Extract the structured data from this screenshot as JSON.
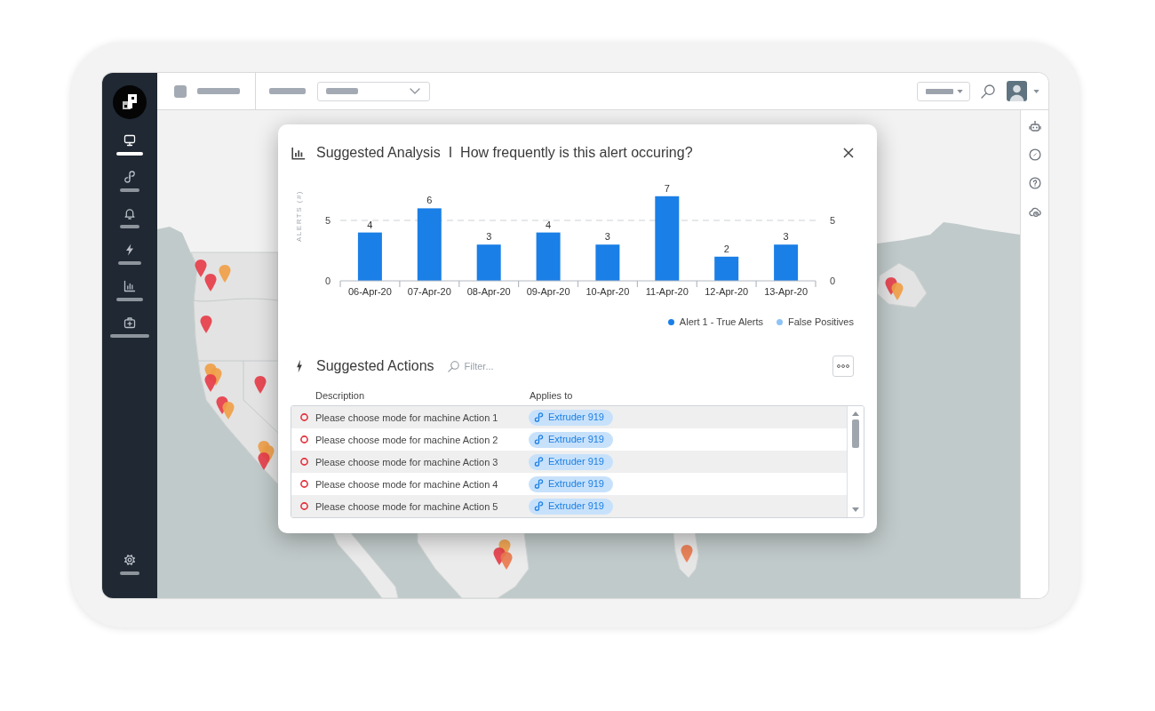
{
  "sidebar": {
    "items": [
      {
        "selected": true
      },
      {
        "selected": false
      },
      {
        "selected": false
      },
      {
        "selected": false
      },
      {
        "selected": false
      },
      {
        "selected": false
      }
    ],
    "footer_items": [
      {
        "selected": false
      }
    ]
  },
  "analysis": {
    "title": "Suggested Analysis",
    "separator": "I",
    "question": "How frequently is this alert occuring?",
    "chart_data": {
      "type": "bar",
      "ylabel": "ALERTS (#)",
      "categories": [
        "06-Apr-20",
        "07-Apr-20",
        "08-Apr-20",
        "09-Apr-20",
        "10-Apr-20",
        "11-Apr-20",
        "12-Apr-20",
        "13-Apr-20"
      ],
      "series": [
        {
          "name": "Alert 1 - True Alerts",
          "color": "#1a7fe6",
          "values": [
            4,
            6,
            3,
            4,
            3,
            7,
            2,
            3
          ]
        },
        {
          "name": "False Positives",
          "color": "#8fc3f7",
          "values": [
            null,
            null,
            null,
            null,
            null,
            null,
            null,
            null
          ]
        }
      ],
      "ylim": [
        0,
        7
      ],
      "yticks": [
        0,
        5
      ],
      "y2lim": [
        0,
        7
      ],
      "y2ticks": [
        0,
        5
      ],
      "data_labels": true
    }
  },
  "actions": {
    "title": "Suggested Actions",
    "filter": {
      "placeholder": "Filter..."
    },
    "columns": [
      "Description",
      "Applies to"
    ],
    "rows": [
      {
        "description": "Please choose mode for machine Action 1",
        "applies_to": "Extruder 919"
      },
      {
        "description": "Please choose mode for machine Action 2",
        "applies_to": "Extruder 919"
      },
      {
        "description": "Please choose mode for machine Action 3",
        "applies_to": "Extruder 919"
      },
      {
        "description": "Please choose mode for machine Action 4",
        "applies_to": "Extruder 919"
      },
      {
        "description": "Please choose mode for machine Action 5",
        "applies_to": "Extruder 919"
      }
    ]
  }
}
